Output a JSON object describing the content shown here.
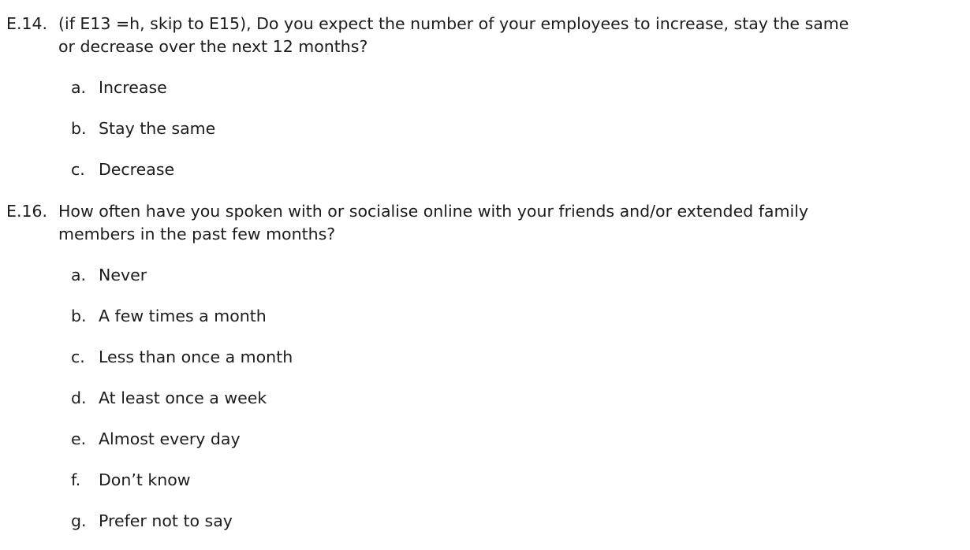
{
  "questions": [
    {
      "number": "E.14.",
      "lines": [
        "(if E13 =h, skip to E15), Do you expect the number of your employees to increase, stay the same",
        "or decrease over the next 12 months?"
      ],
      "options": [
        {
          "letter": "a.",
          "label": "Increase"
        },
        {
          "letter": "b.",
          "label": "Stay the same"
        },
        {
          "letter": "c.",
          "label": "Decrease"
        }
      ]
    },
    {
      "number": "E.16.",
      "lines": [
        "How often have you spoken with or socialise online with your friends and/or extended family",
        "members in the past few months?"
      ],
      "options": [
        {
          "letter": "a.",
          "label": "Never"
        },
        {
          "letter": "b.",
          "label": "A few times a month"
        },
        {
          "letter": "c.",
          "label": "Less than once a month"
        },
        {
          "letter": "d.",
          "label": "At least once a week"
        },
        {
          "letter": "e.",
          "label": "Almost every day"
        },
        {
          "letter": "f.",
          "label": "Don’t know"
        },
        {
          "letter": "g.",
          "label": "Prefer not to say"
        }
      ]
    }
  ]
}
